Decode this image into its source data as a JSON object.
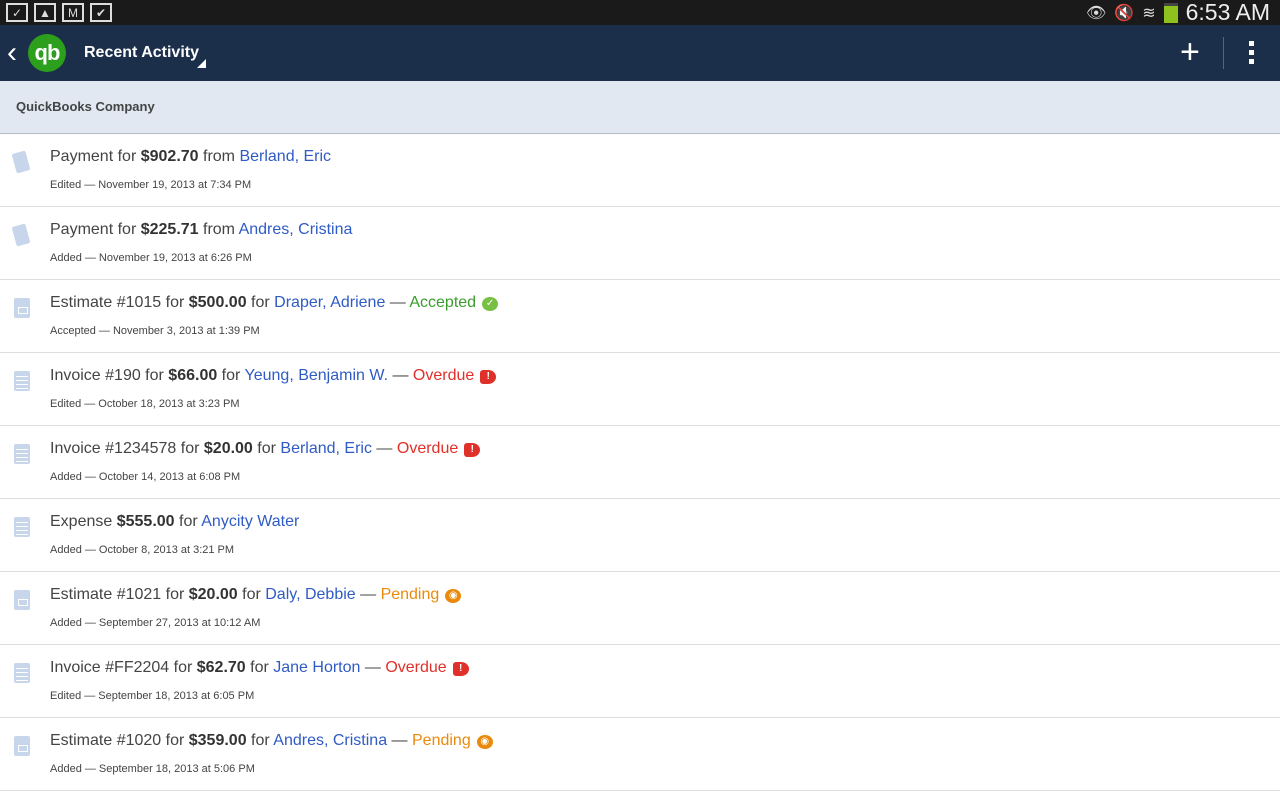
{
  "status_bar": {
    "time": "6:53 AM"
  },
  "app_bar": {
    "title": "Recent Activity",
    "logo": "qb"
  },
  "company": "QuickBooks Company",
  "activities": [
    {
      "icon": "payment",
      "type": "Payment ",
      "mid": " for ",
      "amount": "$902.70",
      "prep": " from ",
      "name": "Berland, Eric",
      "status": "",
      "status_class": "",
      "detail": "Edited — November 19, 2013 at 7:34 PM"
    },
    {
      "icon": "payment",
      "type": "Payment ",
      "mid": " for ",
      "amount": "$225.71",
      "prep": " from ",
      "name": "Andres, Cristina",
      "status": "",
      "status_class": "",
      "detail": "Added — November 19, 2013 at 6:26 PM"
    },
    {
      "icon": "estimate",
      "type": "Estimate #1015",
      "mid": " for ",
      "amount": "$500.00",
      "prep": " for ",
      "name": "Draper, Adriene",
      "status": "Accepted",
      "status_class": "accepted",
      "detail": "Accepted — November 3, 2013 at 1:39 PM"
    },
    {
      "icon": "invoice",
      "type": "Invoice #190",
      "mid": " for ",
      "amount": "$66.00",
      "prep": " for ",
      "name": "Yeung, Benjamin W.",
      "status": "Overdue",
      "status_class": "overdue",
      "detail": "Edited — October 18, 2013 at 3:23 PM"
    },
    {
      "icon": "invoice",
      "type": "Invoice #1234578",
      "mid": " for ",
      "amount": "$20.00",
      "prep": " for ",
      "name": "Berland, Eric",
      "status": "Overdue",
      "status_class": "overdue",
      "detail": "Added — October 14, 2013 at 6:08 PM"
    },
    {
      "icon": "invoice",
      "type": "Expense ",
      "mid": " ",
      "amount": "$555.00",
      "prep": " for ",
      "name": "Anycity Water",
      "status": "",
      "status_class": "",
      "detail": "Added — October 8, 2013 at 3:21 PM"
    },
    {
      "icon": "estimate",
      "type": "Estimate #1021",
      "mid": " for ",
      "amount": "$20.00",
      "prep": " for ",
      "name": "Daly, Debbie",
      "status": "Pending",
      "status_class": "pending",
      "detail": "Added — September 27, 2013 at 10:12 AM"
    },
    {
      "icon": "invoice",
      "type": "Invoice #FF2204",
      "mid": " for ",
      "amount": "$62.70",
      "prep": " for ",
      "name": "Jane Horton",
      "status": "Overdue",
      "status_class": "overdue",
      "detail": "Edited — September 18, 2013 at 6:05 PM"
    },
    {
      "icon": "estimate",
      "type": "Estimate #1020",
      "mid": " for ",
      "amount": "$359.00",
      "prep": " for ",
      "name": "Andres, Cristina",
      "status": "Pending",
      "status_class": "pending",
      "detail": "Added — September 18, 2013 at 5:06 PM"
    }
  ]
}
